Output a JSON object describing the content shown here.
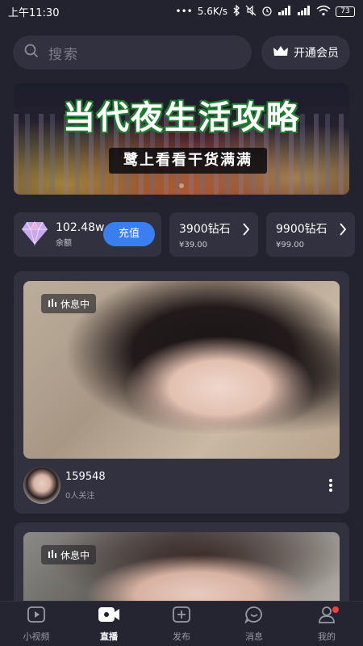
{
  "status_bar": {
    "time": "上午11:30",
    "network_speed": "5.6K/s",
    "battery": "73"
  },
  "search": {
    "placeholder": "搜索"
  },
  "vip_button": {
    "label": "开通会员"
  },
  "banner": {
    "title": "当代夜生活攻略",
    "subtitle": "鹭上看看干货满满"
  },
  "wallet": {
    "balance_value": "102.48w",
    "balance_label": "余额",
    "topup_label": "充值",
    "packages": [
      {
        "amount": "3900钻石",
        "price": "¥39.00"
      },
      {
        "amount": "9900钻石",
        "price": "¥99.00"
      }
    ]
  },
  "streams": [
    {
      "status": "休息中",
      "name": "159548",
      "followers": "0人关注"
    },
    {
      "status": "休息中"
    }
  ],
  "tabs": [
    {
      "label": "小视频",
      "icon": "play-icon"
    },
    {
      "label": "直播",
      "icon": "camera-icon"
    },
    {
      "label": "发布",
      "icon": "plus-icon"
    },
    {
      "label": "消息",
      "icon": "message-icon"
    },
    {
      "label": "我的",
      "icon": "profile-icon"
    }
  ],
  "colors": {
    "accent": "#3a7ef0",
    "background": "#23232f",
    "card": "#31313f",
    "badge": "#f04040"
  }
}
